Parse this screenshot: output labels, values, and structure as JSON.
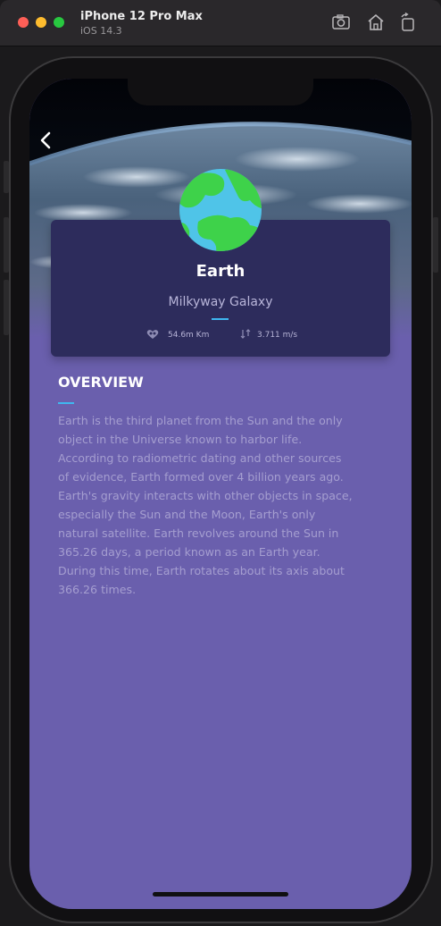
{
  "window": {
    "device_name": "iPhone 12 Pro Max",
    "os_version": "iOS 14.3",
    "toolbar_icons": [
      "screenshot-icon",
      "home-icon",
      "rotate-icon"
    ]
  },
  "planet": {
    "name": "Earth",
    "galaxy": "Milkyway Galaxy",
    "distance": "54.6m Km",
    "gravity": "3.711 m/s"
  },
  "overview": {
    "title": "OVERVIEW",
    "lines": [
      "Earth is the third planet from the Sun and the only",
      "object in the Universe known to harbor life.",
      "According to radiometric dating and other sources",
      "of evidence, Earth formed over 4 billion years ago.",
      "Earth's gravity interacts with other objects in space,",
      "especially the Sun and the Moon, Earth's only",
      "natural satellite. Earth revolves around the Sun in",
      "365.26 days, a period known as an Earth year.",
      "During this time, Earth rotates about its axis about",
      "366.26 times."
    ]
  },
  "colors": {
    "background": "#6a5fad",
    "card": "#2d2c5c",
    "accent": "#3fb7f0",
    "planet_ocean": "#4fc4e8",
    "planet_land": "#3ed24a"
  }
}
